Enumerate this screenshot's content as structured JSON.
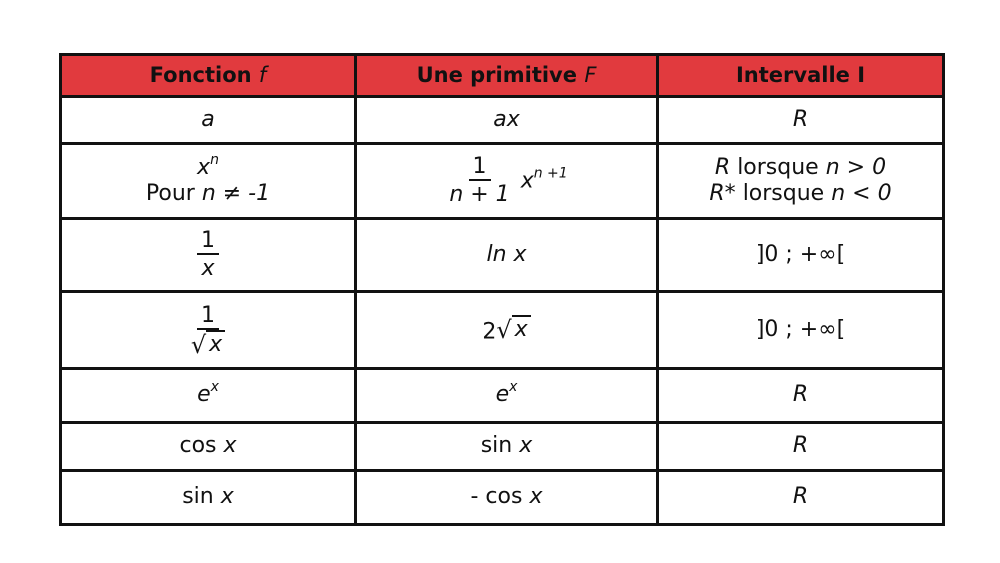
{
  "table": {
    "header": {
      "col1": {
        "label": "Fonction",
        "symbol": "f"
      },
      "col2": {
        "label": "Une primitive",
        "symbol": "F"
      },
      "col3": {
        "label": "Intervalle I"
      }
    },
    "colors": {
      "header_bg": "#e13a3e",
      "border": "#111111"
    },
    "rows": [
      {
        "f": "a",
        "F": "ax",
        "I": "R"
      },
      {
        "f_base": "x",
        "f_exp": "n",
        "f_cond_prefix": "Pour",
        "f_cond": "n ≠ -1",
        "F_num": "1",
        "F_den": "n + 1",
        "F_base": "x",
        "F_exp": "n +1",
        "I_line1_sym": "R",
        "I_line1_text": "lorsque",
        "I_line1_cond": "n > 0",
        "I_line2_sym": "R*",
        "I_line2_text": "lorsque",
        "I_line2_cond": "n < 0"
      },
      {
        "f_num": "1",
        "f_den": "x",
        "F": "ln x",
        "I": "]0 ; +∞["
      },
      {
        "f_num": "1",
        "f_rad": "√",
        "f_den": "x",
        "F_coef": "2",
        "F_rad": "√",
        "F_under": "x",
        "I": "]0 ; +∞["
      },
      {
        "f_base": "e",
        "f_exp": "x",
        "F_base": "e",
        "F_exp": "x",
        "I": "R"
      },
      {
        "f_fn": "cos",
        "f_var": "x",
        "F_fn": "sin",
        "F_var": "x",
        "I": "R"
      },
      {
        "f_fn": "sin",
        "f_var": "x",
        "F_fn": "- cos",
        "F_var": "x",
        "I": "R"
      }
    ]
  }
}
